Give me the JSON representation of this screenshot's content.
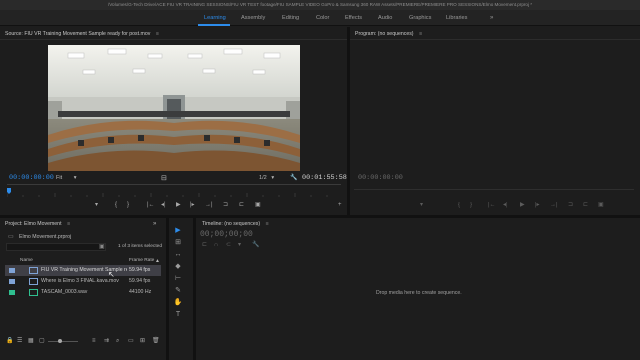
{
  "titlebar": {
    "path": "/Volumes/G-Tech Drive/ACE FIU VR TRAINING SESSIONS/FIU VR TEST footage/FIU SAMPLE VIDEO GoPro & Samsung 360 RAW Assets/PREMIERE/PREMIERE PRO SESSIONS/Elmo Movement.prproj *"
  },
  "workspaces": [
    "Learning",
    "Assembly",
    "Editing",
    "Color",
    "Effects",
    "Audio",
    "Graphics",
    "Libraries"
  ],
  "workspace_more": "»",
  "source": {
    "title": "Source: FIU VR Training Movement Sample ready for post.mov",
    "menu_icon": "≡",
    "timecode_in": "00:00:00:00",
    "fit": "Fit",
    "fit_arrow": "▾",
    "ratio": "1/2",
    "ratio_arrow": "▾",
    "duration": "00:01:55:58",
    "wrench": "🔧"
  },
  "program": {
    "title": "Program: (no sequences)",
    "menu_icon": "≡",
    "timecode": "00:00:00:00"
  },
  "transport": [
    "▾",
    "{",
    "}",
    "|←",
    "◂|",
    "▶",
    "|▸",
    "→|",
    "⊐",
    "⊏",
    "▣",
    "◉"
  ],
  "transport_plus": "+",
  "program_transport": [
    "▾",
    "{",
    "}",
    "|←",
    "◂|",
    "▶",
    "|▸",
    "→|",
    "⊐",
    "⊏",
    "▣"
  ],
  "project": {
    "title": "Project: Elmo Movement",
    "menu_icon": "≡",
    "more": "»",
    "filename": "Elmo Movement.prproj",
    "selected_count": "1 of 3 items selected",
    "col_name": "Name",
    "col_rate": "Frame Rate",
    "sort_arrow": "▲",
    "items": [
      {
        "name": "FIU VR Training Movement Sample ready for post.mov",
        "rate": "59.94 fps",
        "color": "#7fa3d6"
      },
      {
        "name": "Where is Elmo 3 FINAL.kava.mov",
        "rate": "59.94 fps",
        "color": "#7fa3d6"
      },
      {
        "name": "TASCAM_0003.wav",
        "rate": "44100 Hz",
        "color": "#2fbf8f"
      }
    ]
  },
  "tools": [
    "▶",
    "⊞",
    "↔",
    "◆",
    "⊢",
    "✎",
    "✋",
    "T"
  ],
  "timeline": {
    "title": "Timeline: (no sequences)",
    "menu_icon": "≡",
    "timecode": "00;00;00;00",
    "empty_message": "Drop media here to create sequence."
  },
  "colors": {
    "accent": "#2d8ceb",
    "bg": "#1d1d1d",
    "panel": "#232323"
  }
}
